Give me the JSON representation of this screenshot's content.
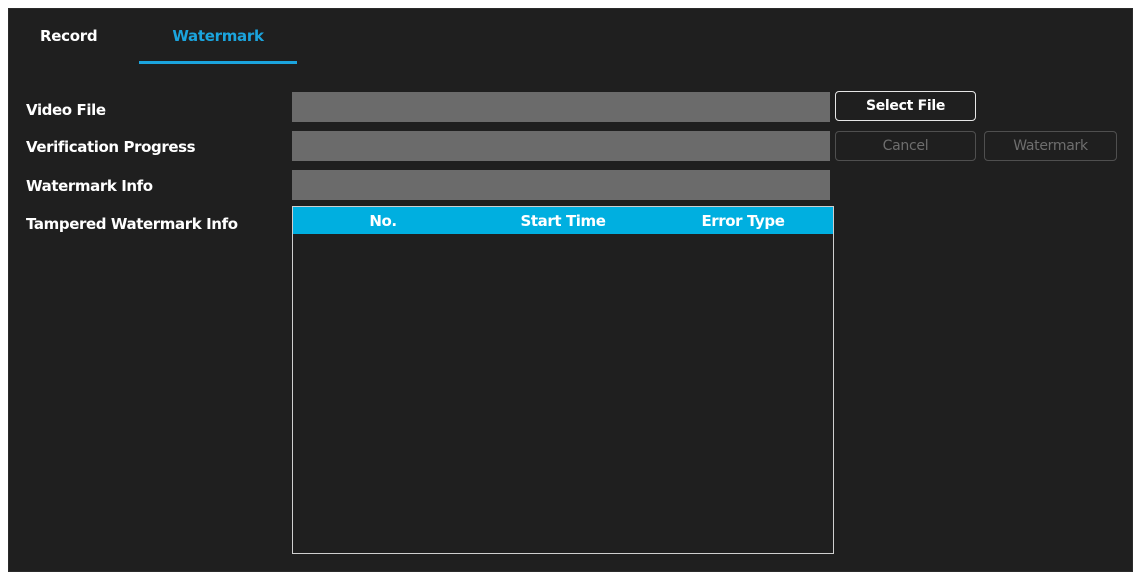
{
  "tabs": [
    {
      "label": "Record",
      "active": false
    },
    {
      "label": "Watermark",
      "active": true
    }
  ],
  "accent_color": "#1ba4dd",
  "form": {
    "video_file_label": "Video File",
    "video_file_value": "",
    "verification_progress_label": "Verification Progress",
    "verification_progress_value": "",
    "watermark_info_label": "Watermark Info",
    "watermark_info_value": "",
    "tampered_label": "Tampered Watermark Info"
  },
  "buttons": {
    "select_file": "Select File",
    "cancel": "Cancel",
    "watermark": "Watermark"
  },
  "table": {
    "columns": [
      "No.",
      "Start Time",
      "Error Type"
    ],
    "rows": []
  }
}
